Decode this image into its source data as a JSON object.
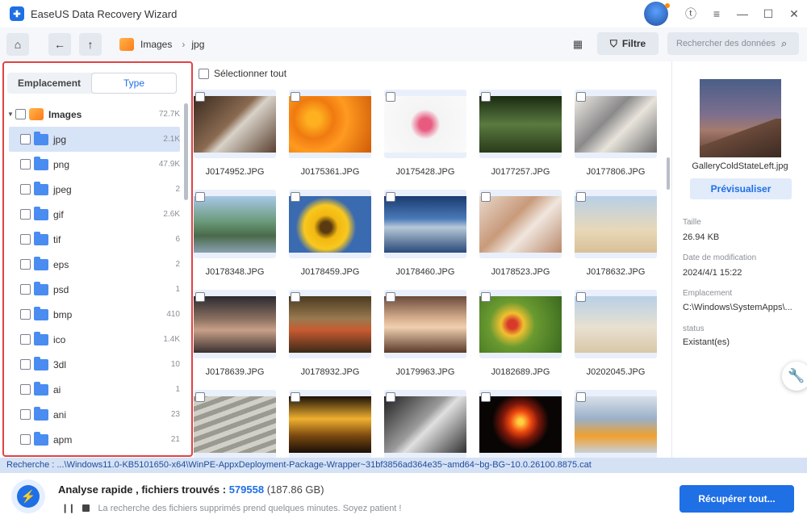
{
  "titlebar": {
    "app_title": "EaseUS Data Recovery Wizard"
  },
  "toolbar": {
    "breadcrumb": [
      "Images",
      "jpg"
    ],
    "filter_label": "Filtre",
    "search_placeholder": "Rechercher des données"
  },
  "left_panel": {
    "tabs": [
      {
        "label": "Emplacement",
        "active": false
      },
      {
        "label": "Type",
        "active": true
      }
    ],
    "root": {
      "label": "Images",
      "count": "72.7K"
    },
    "items": [
      {
        "label": "jpg",
        "count": "2.1K",
        "selected": true
      },
      {
        "label": "png",
        "count": "47.9K"
      },
      {
        "label": "jpeg",
        "count": "2"
      },
      {
        "label": "gif",
        "count": "2.6K"
      },
      {
        "label": "tif",
        "count": "6"
      },
      {
        "label": "eps",
        "count": "2"
      },
      {
        "label": "psd",
        "count": "1"
      },
      {
        "label": "bmp",
        "count": "410"
      },
      {
        "label": "ico",
        "count": "1.4K"
      },
      {
        "label": "3dl",
        "count": "10"
      },
      {
        "label": "ai",
        "count": "1"
      },
      {
        "label": "ani",
        "count": "23"
      },
      {
        "label": "apm",
        "count": "21"
      }
    ]
  },
  "main": {
    "select_all": "Sélectionner tout",
    "files": [
      "J0174952.JPG",
      "J0175361.JPG",
      "J0175428.JPG",
      "J0177257.JPG",
      "J0177806.JPG",
      "J0178348.JPG",
      "J0178459.JPG",
      "J0178460.JPG",
      "J0178523.JPG",
      "J0178632.JPG",
      "J0178639.JPG",
      "J0178932.JPG",
      "J0179963.JPG",
      "J0182689.JPG",
      "J0202045.JPG",
      "",
      "",
      "",
      "",
      ""
    ]
  },
  "right_panel": {
    "preview_name": "GalleryColdStateLeft.jpg",
    "preview_button": "Prévisualiser",
    "meta": [
      {
        "label": "Taille",
        "value": "26.94 KB"
      },
      {
        "label": "Date de modification",
        "value": "2024/4/1 15:22"
      },
      {
        "label": "Emplacement",
        "value": "C:\\Windows\\SystemApps\\..."
      },
      {
        "label": "status",
        "value": "Existant(es)"
      }
    ]
  },
  "pathbar": {
    "text": "Recherche : ...\\Windows11.0-KB5101650-x64\\WinPE-AppxDeployment-Package-Wrapper~31bf3856ad364e35~amd64~bg-BG~10.0.26100.8875.cat"
  },
  "footer": {
    "scan_label": "Analyse rapide , fichiers trouvés :",
    "scan_count": "579558",
    "scan_size": "(187.86 GB)",
    "note": "La recherche des fichiers supprimés prend quelques minutes. Soyez patient !",
    "recover_button": "Récupérer tout..."
  },
  "colors": {
    "accent": "#1f6fe5",
    "highlight_border": "#e14343",
    "selection": "#d7e3f7"
  }
}
